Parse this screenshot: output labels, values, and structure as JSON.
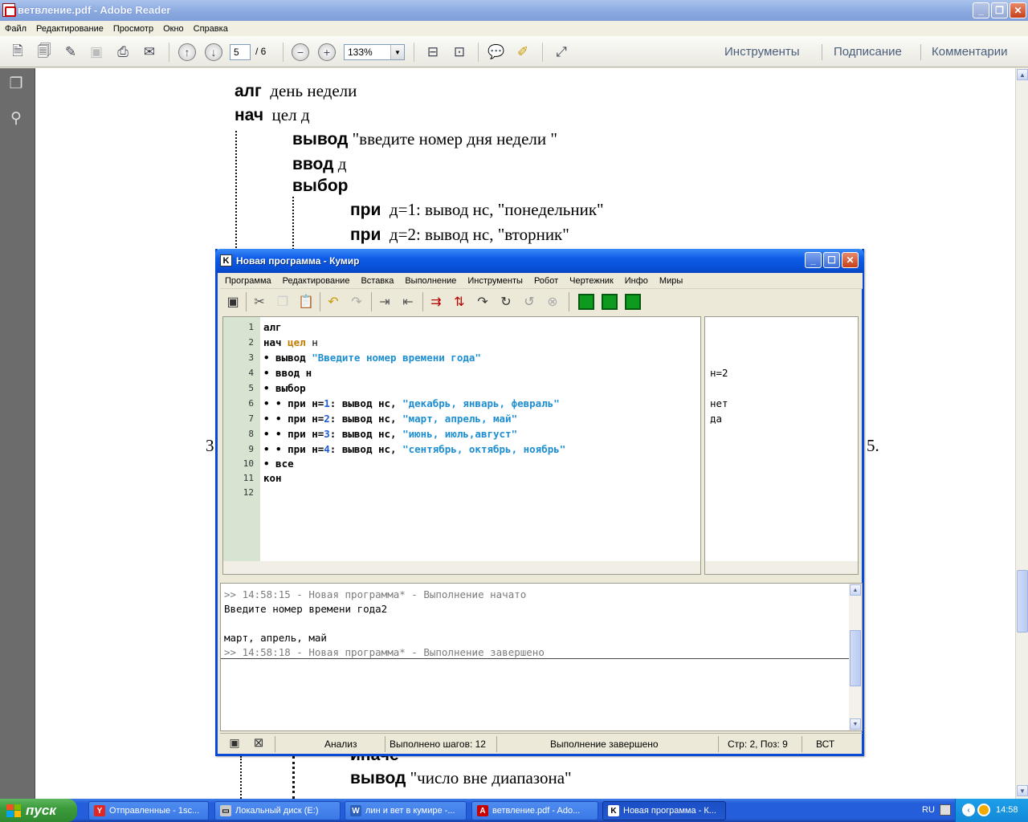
{
  "reader": {
    "title": "ветвление.pdf - Adobe Reader",
    "menu": [
      "Файл",
      "Редактирование",
      "Просмотр",
      "Окно",
      "Справка"
    ],
    "page_current": "5",
    "page_total": "/ 6",
    "zoom": "133%",
    "panels": [
      "Инструменты",
      "Подписание",
      "Комментарии"
    ],
    "doc": {
      "l1_kw": "алг",
      "l1_text": "день недели",
      "l2_kw": "нач",
      "l2_text": "цел д",
      "l3_kw": "вывод",
      "l3_text": "\"введите номер дня недели \"",
      "l4_kw": "ввод",
      "l4_text": "д",
      "l5_kw": "выбор",
      "l6_kw": "при",
      "l6_text": "д=1:  вывод  нс, \"понедельник\"",
      "l7_kw": "при",
      "l7_text": "д=2:  вывод  нс, \"вторник\"",
      "left_frag": "3",
      "right_frag": "5.",
      "l8_text": "иначе",
      "l9_kw": "вывод",
      "l9_text": "\"число вне диапазона\""
    }
  },
  "kumir": {
    "title": "Новая программа - Кумир",
    "menu": [
      "Программа",
      "Редактирование",
      "Вставка",
      "Выполнение",
      "Инструменты",
      "Робот",
      "Чертежник",
      "Инфо",
      "Миры"
    ],
    "line_numbers": [
      "1",
      "2",
      "3",
      "4",
      "5",
      "6",
      "7",
      "8",
      "9",
      "10",
      "11",
      "12"
    ],
    "code": {
      "l1": "алг",
      "l2a": "нач ",
      "l2b": "цел",
      "l2c": " н",
      "l3a": "• вывод ",
      "l3b": "\"Введите номер времени года\"",
      "l4": "• ввод н",
      "l5": "• выбор",
      "l6a": "• • при н=",
      "l6n": "1",
      "l6b": ": вывод нс, ",
      "l6s": "\"декабрь, январь, февраль\"",
      "l7a": "• • при н=",
      "l7n": "2",
      "l7b": ": вывод нс, ",
      "l7s": "\"март, апрель, май\"",
      "l8a": "• • при н=",
      "l8n": "3",
      "l8b": ": вывод нс, ",
      "l8s": "\"июнь, июль,август\"",
      "l9a": "• • при н=",
      "l9n": "4",
      "l9b": ": вывод нс, ",
      "l9s": "\"сентябрь, октябрь, ноябрь\"",
      "l10": "• все",
      "l11": "кон"
    },
    "margin": {
      "m4": "н=2",
      "m6": "нет",
      "m7": "да"
    },
    "console": {
      "c1": ">> 14:58:15 - Новая программа* - Выполнение начато",
      "c2": "Введите номер времени года2",
      "c3": "март, апрель, май",
      "c4": ">> 14:58:18 - Новая программа* - Выполнение завершено"
    },
    "status": {
      "analysis": "Анализ",
      "steps": "Выполнено шагов: 12",
      "state": "Выполнение завершено",
      "position": "Стр: 2, Поз: 9",
      "mode": "ВСТ"
    }
  },
  "taskbar": {
    "start": "пуск",
    "tasks": [
      "Отправленные - 1sc...",
      "Локальный диск (E:)",
      "лин и вет в кумире -...",
      "ветвление.pdf - Ado...",
      "Новая программа - К..."
    ],
    "lang": "RU",
    "clock": "14:58"
  }
}
